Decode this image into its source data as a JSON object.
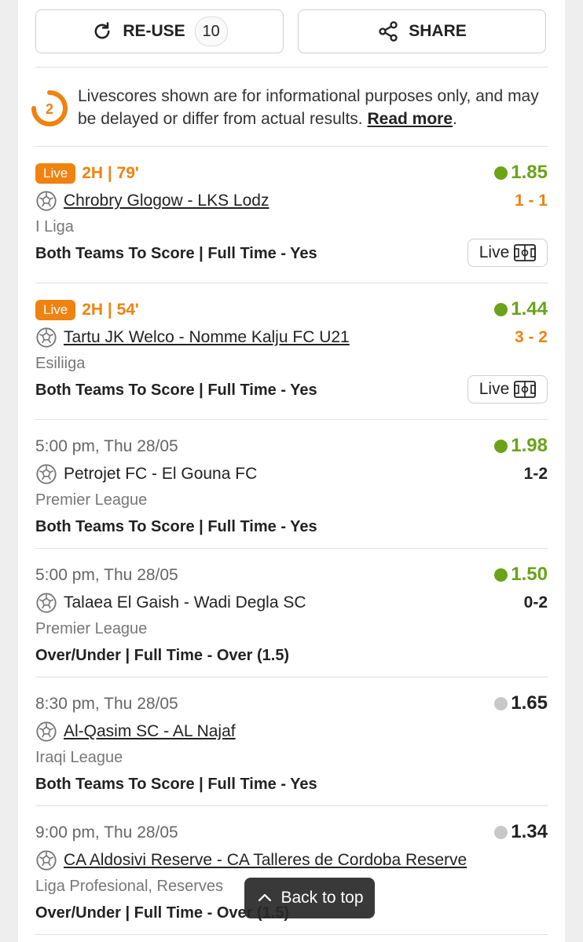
{
  "actions": {
    "reuse_label": "RE-USE",
    "reuse_count": "10",
    "share_label": "SHARE"
  },
  "notice": {
    "badge": "2",
    "text": "Livescores shown are for informational purposes only, and may be delayed or differ from actual results.",
    "link": "Read more",
    "suffix": "."
  },
  "colors": {
    "accent": "#f0820f",
    "odds_live": "#6aa318",
    "odds_pending": "#c8c8c8"
  },
  "bets": [
    {
      "live": true,
      "live_label": "Live",
      "time": "2H | 79'",
      "odds": "1.85",
      "status": "green",
      "match": "Chrobry Glogow - LKS Lodz",
      "link": true,
      "score": "1 - 1",
      "score_live": true,
      "league": "I Liga",
      "market": "Both Teams To Score | Full Time - Yes",
      "live_button": "Live"
    },
    {
      "live": true,
      "live_label": "Live",
      "time": "2H | 54'",
      "odds": "1.44",
      "status": "green",
      "match": "Tartu JK Welco - Nomme Kalju FC U21",
      "link": true,
      "score": "3 - 2",
      "score_live": true,
      "league": "Esiliiga",
      "market": "Both Teams To Score | Full Time - Yes",
      "live_button": "Live"
    },
    {
      "live": false,
      "time": "5:00 pm, Thu 28/05",
      "odds": "1.98",
      "status": "green",
      "match": "Petrojet FC - El Gouna FC",
      "link": false,
      "score": "1-2",
      "score_live": false,
      "league": "Premier League",
      "market": "Both Teams To Score | Full Time - Yes"
    },
    {
      "live": false,
      "time": "5:00 pm, Thu 28/05",
      "odds": "1.50",
      "status": "green",
      "match": "Talaea El Gaish - Wadi Degla SC",
      "link": false,
      "score": "0-2",
      "score_live": false,
      "league": "Premier League",
      "market": "Over/Under | Full Time - Over (1.5)"
    },
    {
      "live": false,
      "time": "8:30 pm, Thu 28/05",
      "odds": "1.65",
      "status": "grey",
      "match": "Al-Qasim SC - AL Najaf",
      "link": true,
      "score": "",
      "league": "Iraqi League",
      "market": "Both Teams To Score | Full Time - Yes"
    },
    {
      "live": false,
      "time": "9:00 pm, Thu 28/05",
      "odds": "1.34",
      "status": "grey",
      "match": "CA Aldosivi Reserve - CA Talleres de Cordoba Reserve",
      "link": true,
      "score": "",
      "league": "Liga Profesional, Reserves",
      "market": "Over/Under | Full Time - Over (1.5)"
    }
  ],
  "back_to_top": "Back to top"
}
